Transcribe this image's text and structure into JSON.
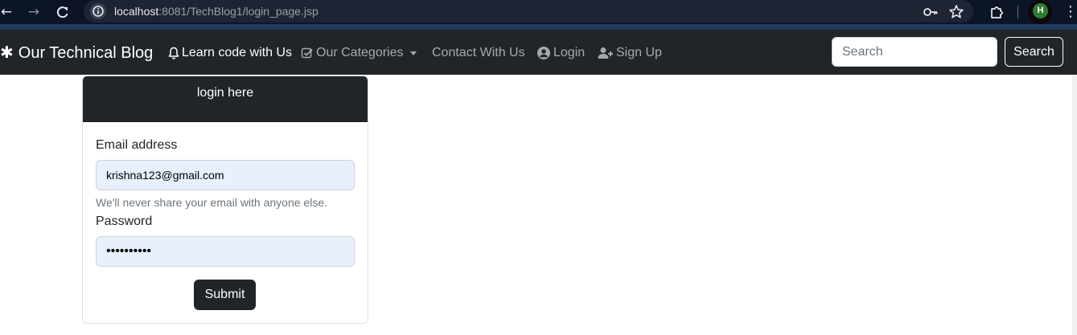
{
  "browser": {
    "url_host": "localhost",
    "url_rest": ":8081/TechBlog1/login_page.jsp",
    "profile_initial": "H",
    "icons": [
      "back-icon",
      "forward-icon",
      "reload-icon",
      "site-info-icon",
      "password-key-icon",
      "bookmark-star-icon",
      "extensions-icon",
      "menu-icon"
    ]
  },
  "navbar": {
    "brand": "Our Technical Blog",
    "brand_icon": "asterisk-icon",
    "links": [
      {
        "label": "Learn code with Us",
        "icon": "bell-icon",
        "active": true
      },
      {
        "label": "Our Categories",
        "icon": "check-square-icon",
        "dropdown": true
      },
      {
        "label": "Contact With Us"
      },
      {
        "label": "Login",
        "icon": "user-circle-icon"
      },
      {
        "label": "Sign Up",
        "icon": "user-plus-icon"
      }
    ],
    "search": {
      "placeholder": "Search",
      "value": ""
    },
    "search_button": "Search"
  },
  "login_card": {
    "title": "login here",
    "email_label": "Email address",
    "email_value": "krishna123@gmail.com",
    "email_help": "We'll never share your email with anyone else.",
    "password_label": "Password",
    "password_value": "••••••••••",
    "submit_label": "Submit"
  },
  "colors": {
    "navbar_bg": "#212529",
    "card_header_bg": "#212529",
    "autofill_bg": "#e8f0fe",
    "button_bg": "#212529"
  }
}
